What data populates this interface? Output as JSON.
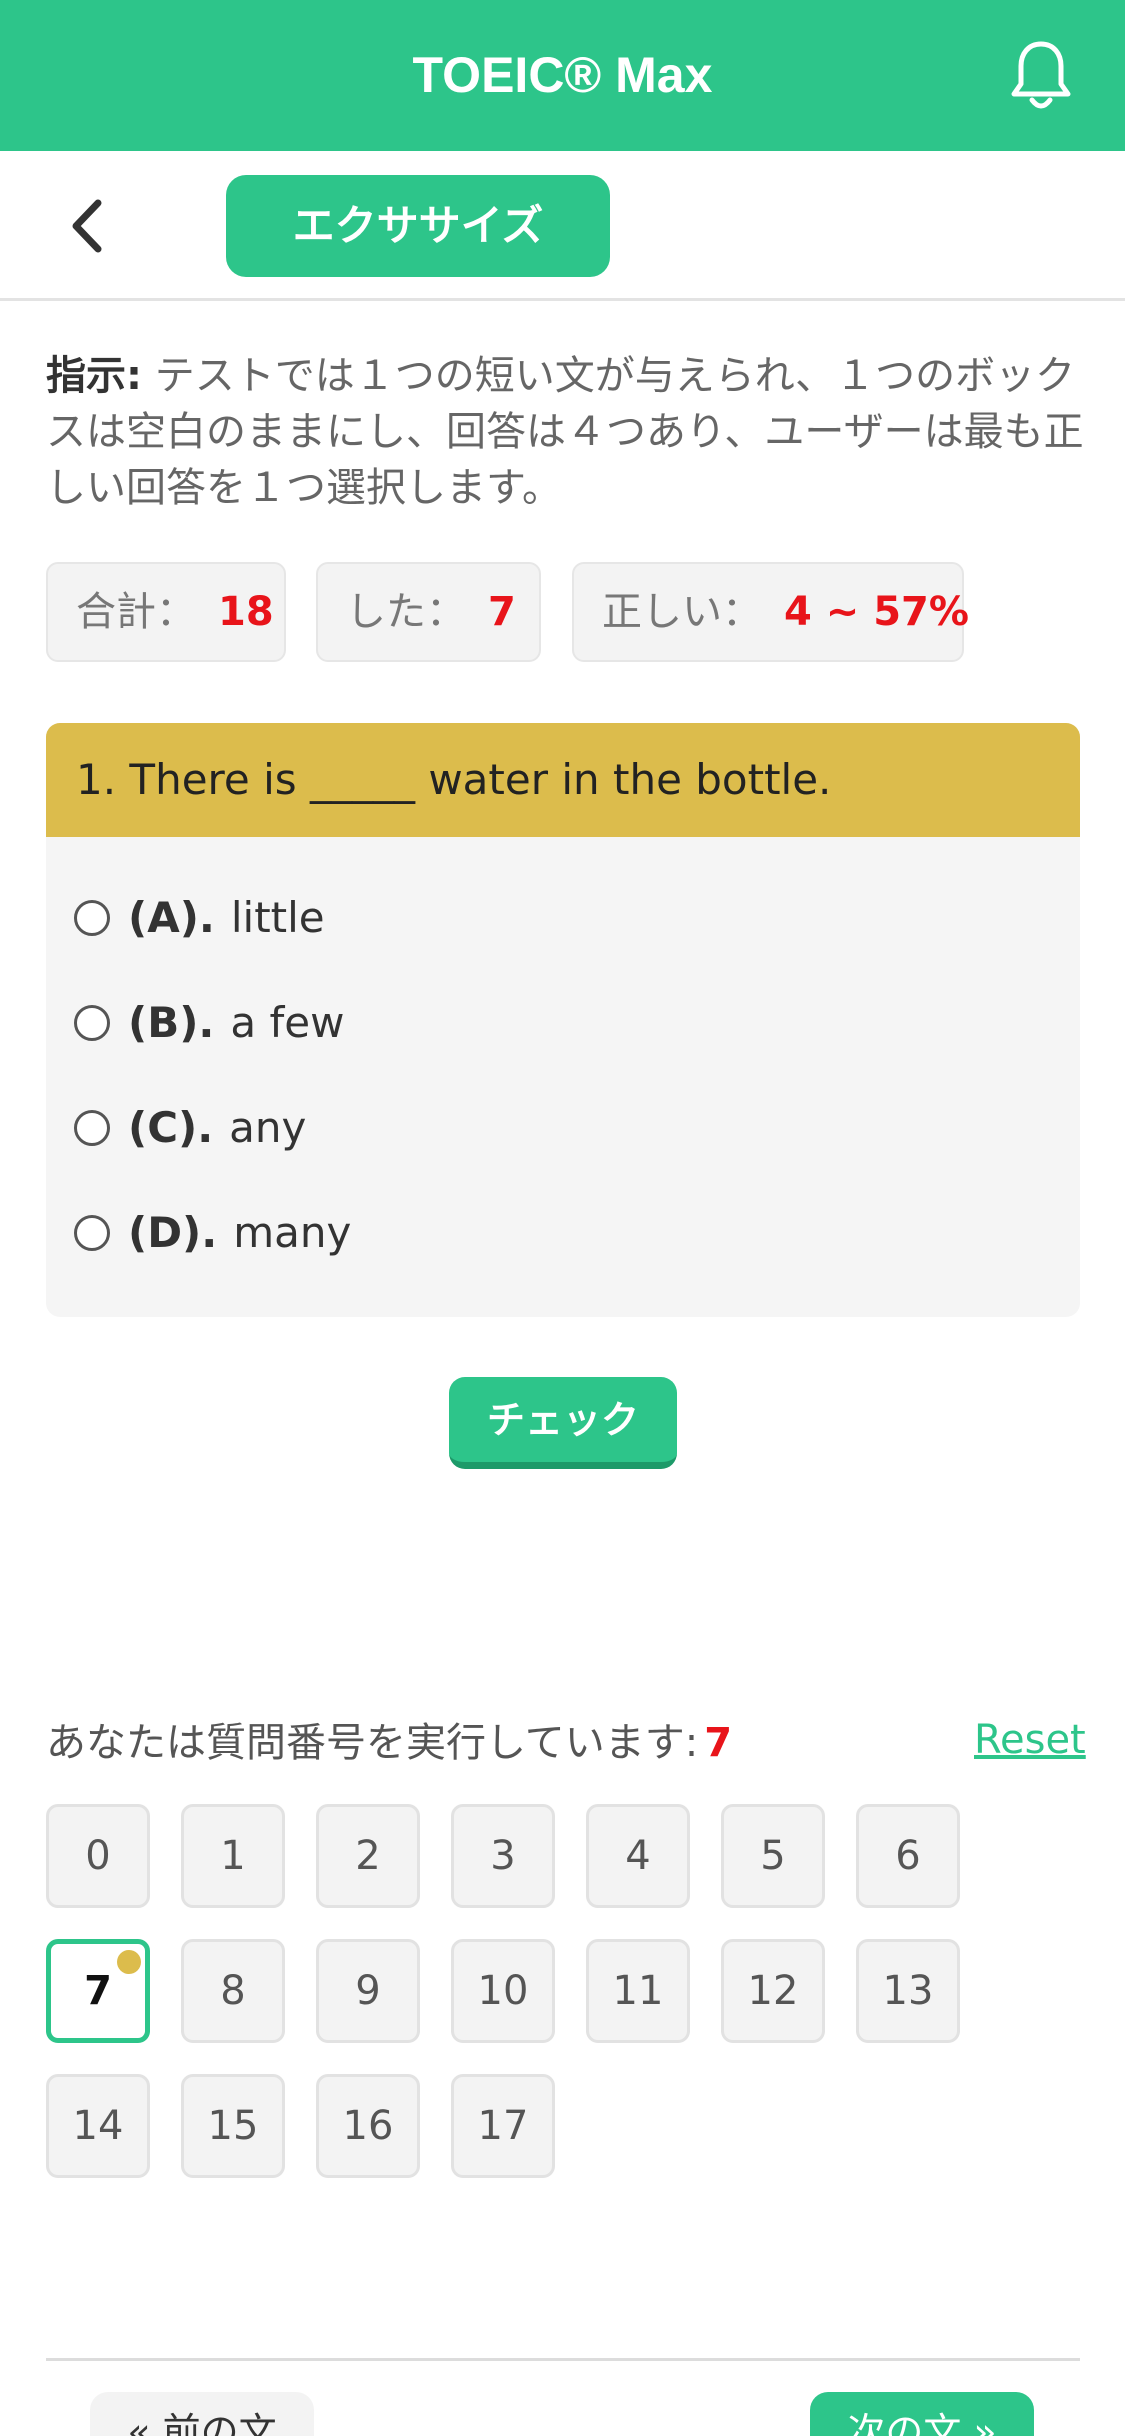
{
  "header": {
    "title": "TOEIC® Max",
    "bell_icon": "bell-icon"
  },
  "subbar": {
    "back_icon": "chevron-left-icon",
    "tab_label": "エクササイズ"
  },
  "instruction": {
    "label": "指示:",
    "text": " テストでは１つの短い文が与えられ、１つのボックスは空白のままにし、回答は４つあり、ユーザーは最も正しい回答を１つ選択します。"
  },
  "stats": {
    "total_label": "合計：",
    "total_value": "18",
    "done_label": "した：",
    "done_value": "7",
    "correct_label": "正しい：",
    "correct_value": "4 ~ 57%"
  },
  "question": {
    "text": "1. There is _____ water in the bottle.",
    "options": [
      {
        "key": "(A).",
        "text": "little"
      },
      {
        "key": "(B).",
        "text": "a few"
      },
      {
        "key": "(C).",
        "text": "any"
      },
      {
        "key": "(D).",
        "text": "many"
      }
    ]
  },
  "check_label": "チェック",
  "progress": {
    "running_label": "あなたは質問番号を実行しています:",
    "current": "7",
    "reset_label": "Reset",
    "numbers": [
      "0",
      "1",
      "2",
      "3",
      "4",
      "5",
      "6",
      "7",
      "8",
      "9",
      "10",
      "11",
      "12",
      "13",
      "14",
      "15",
      "16",
      "17"
    ]
  },
  "nav": {
    "prev_label": "« 前の文",
    "next_label": "次の文 »"
  },
  "colors": {
    "accent": "#2dc58a",
    "question_header": "#dcbc4c",
    "highlight": "#e8141a"
  }
}
